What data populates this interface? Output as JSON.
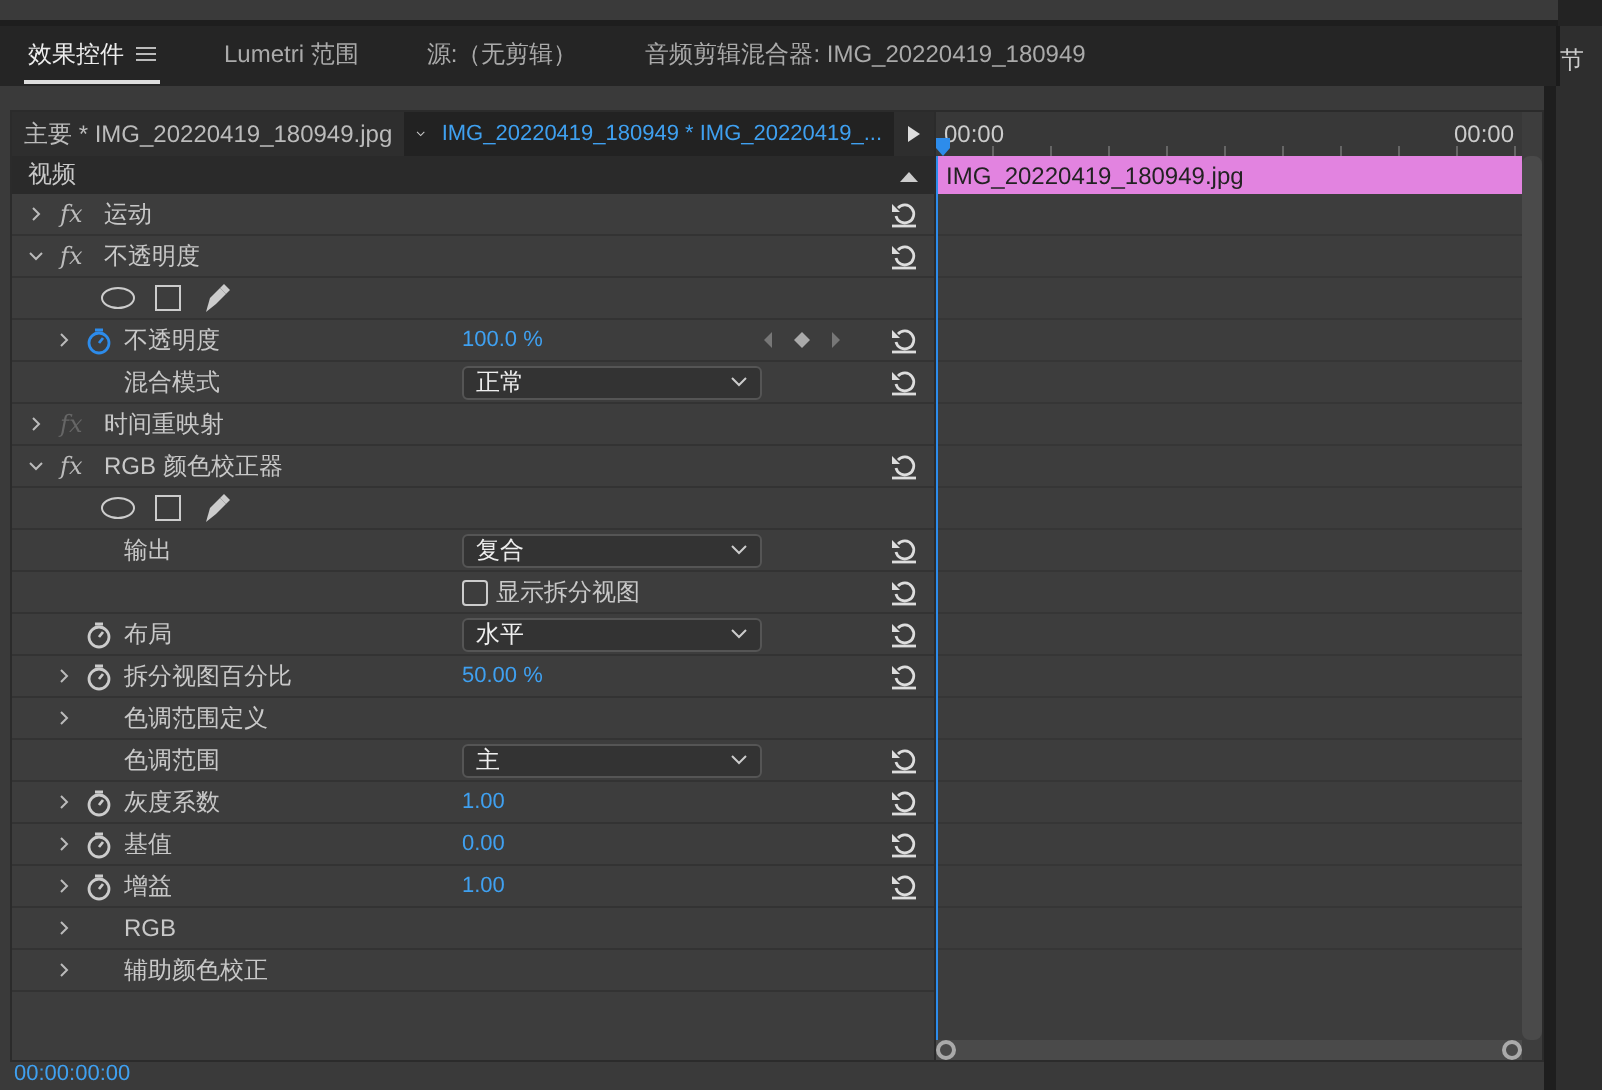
{
  "panel_tabs": [
    {
      "label": "效果控件",
      "selected": true,
      "menu": true
    },
    {
      "label": "Lumetri 范围",
      "selected": false,
      "menu": false
    },
    {
      "label": "源:（无剪辑）",
      "selected": false,
      "menu": false
    },
    {
      "label": "音频剪辑混合器: IMG_20220419_180949",
      "selected": false,
      "menu": false
    }
  ],
  "next_panel_tab": "节",
  "source_bar": {
    "master": "主要 * IMG_20220419_180949.jpg",
    "clip": "IMG_20220419_180949 * IMG_20220419_..."
  },
  "section": {
    "label": "视频"
  },
  "rows": [
    {
      "kind": "effect",
      "label": "运动",
      "badge": "fx",
      "expanded": false,
      "enabled": true
    },
    {
      "kind": "effect",
      "label": "不透明度",
      "badge": "fx",
      "expanded": true,
      "enabled": true
    },
    {
      "kind": "mask_tools"
    },
    {
      "kind": "property",
      "label": "不透明度",
      "expandable": true,
      "stopwatch": {
        "animating": true
      },
      "number": "100.0 %",
      "keyframes": true,
      "reset": true
    },
    {
      "kind": "property",
      "label": "混合模式",
      "dropdown": "正常",
      "reset": true
    },
    {
      "kind": "effect",
      "label": "时间重映射",
      "badge": "fx",
      "expanded": false,
      "enabled": false
    },
    {
      "kind": "effect",
      "label": "RGB 颜色校正器",
      "badge": "fx",
      "expanded": true,
      "enabled": true
    },
    {
      "kind": "mask_tools"
    },
    {
      "kind": "property",
      "label": "输出",
      "dropdown": "复合",
      "reset": true
    },
    {
      "kind": "property",
      "checkbox": {
        "label": "显示拆分视图",
        "checked": false
      },
      "reset": true
    },
    {
      "kind": "property",
      "label": "布局",
      "stopwatch": {
        "animating": false
      },
      "dropdown": "水平",
      "reset": true
    },
    {
      "kind": "property",
      "label": "拆分视图百分比",
      "expandable": true,
      "stopwatch": {
        "animating": false
      },
      "number": "50.00 %",
      "reset": true
    },
    {
      "kind": "property",
      "label": "色调范围定义",
      "expandable": true
    },
    {
      "kind": "property",
      "label": "色调范围",
      "dropdown": "主",
      "reset": true
    },
    {
      "kind": "property",
      "label": "灰度系数",
      "expandable": true,
      "stopwatch": {
        "animating": false
      },
      "number": "1.00",
      "reset": true
    },
    {
      "kind": "property",
      "label": "基值",
      "expandable": true,
      "stopwatch": {
        "animating": false
      },
      "number": "0.00",
      "reset": true
    },
    {
      "kind": "property",
      "label": "增益",
      "expandable": true,
      "stopwatch": {
        "animating": false
      },
      "number": "1.00",
      "reset": true
    },
    {
      "kind": "property",
      "label": "RGB",
      "expandable": true
    },
    {
      "kind": "property",
      "label": "辅助颜色校正",
      "expandable": true
    }
  ],
  "timeline": {
    "ruler": [
      "00:00",
      "00:00"
    ],
    "clip": "IMG_20220419_180949.jpg"
  },
  "timecode": "00:00:00:00"
}
